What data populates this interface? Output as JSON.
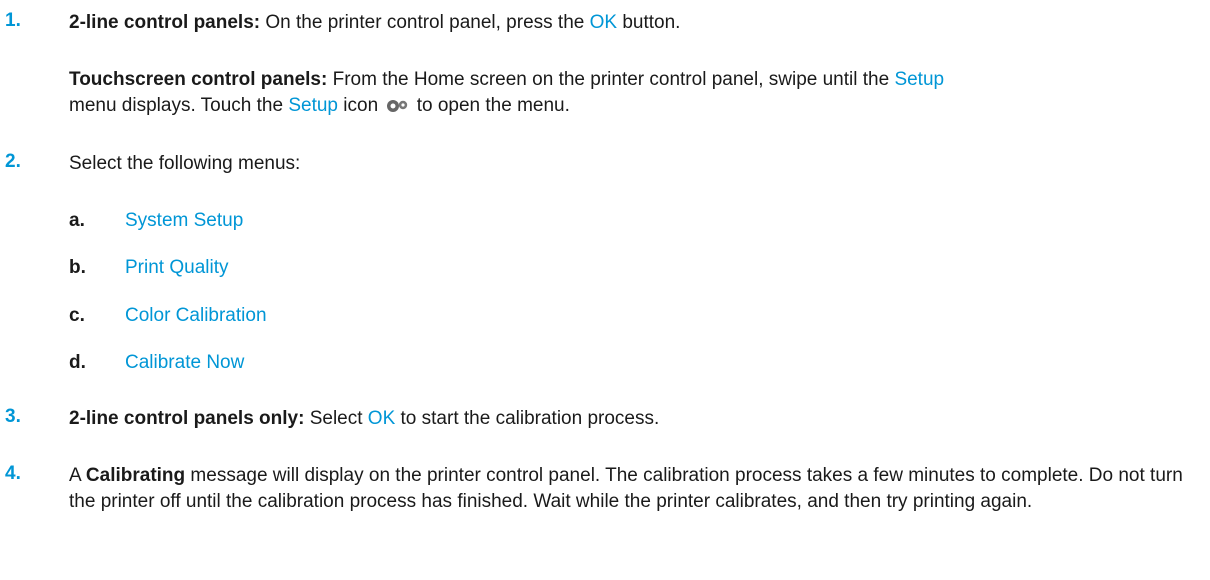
{
  "step1": {
    "number": "1.",
    "label": "2-line control panels:",
    "text_before": " On the printer control panel, press the ",
    "ok": "OK",
    "text_after": " button.",
    "touch_label": "Touchscreen control panels:",
    "touch_text1": " From the Home screen on the printer control panel, swipe until the ",
    "setup1": "Setup",
    "touch_text2": " menu displays. Touch the ",
    "setup2": "Setup",
    "touch_text3": " icon ",
    "touch_text4": " to open the menu."
  },
  "step2": {
    "number": "2.",
    "text": "Select the following menus:",
    "items": [
      {
        "letter": "a.",
        "label": "System Setup"
      },
      {
        "letter": "b.",
        "label": "Print Quality"
      },
      {
        "letter": "c.",
        "label": "Color Calibration"
      },
      {
        "letter": "d.",
        "label": "Calibrate Now"
      }
    ]
  },
  "step3": {
    "number": "3.",
    "label": "2-line control panels only:",
    "text_before": " Select ",
    "ok": "OK",
    "text_after": " to start the calibration process."
  },
  "step4": {
    "number": "4.",
    "text_before": "A ",
    "bold": "Calibrating",
    "text_after": " message will display on the printer control panel. The calibration process takes a few minutes to complete. Do not turn the printer off until the calibration process has finished. Wait while the printer calibrates, and then try printing again."
  },
  "colors": {
    "link": "#0096d6",
    "text": "#1a1a1a"
  }
}
